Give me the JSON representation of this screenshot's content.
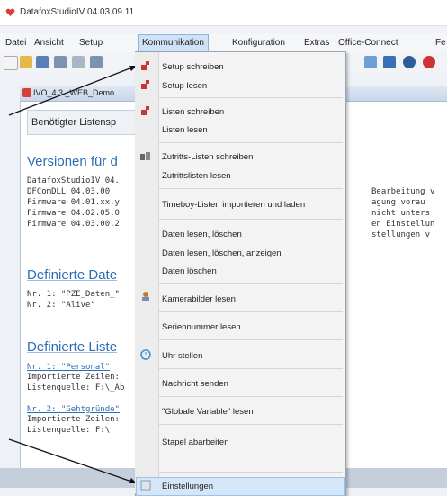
{
  "window": {
    "title": "DatafoxStudioIV 04.03.09.11"
  },
  "menubar": [
    {
      "label": "Datei"
    },
    {
      "label": "Ansicht"
    },
    {
      "label": "Setup"
    },
    {
      "label": "Kommunikation"
    },
    {
      "label": "Konfiguration"
    },
    {
      "label": "Extras"
    },
    {
      "label": "Office-Connect"
    },
    {
      "label": "Fe"
    }
  ],
  "doc": {
    "tab_title": "IVO_4.3._WEB_Demo",
    "needed_label": "Benötigter Listensp",
    "versions_heading": "Versionen für d",
    "version_lines": [
      "DatafoxStudioIV 04.",
      "DFComDLL 04.03.00",
      "Firmware 04.01.xx.y",
      "Firmware 04.02.05.0",
      "Firmware 04.03.00.2"
    ],
    "right_lines": [
      "Bearbeitung v",
      "agung vorau",
      "nicht unters",
      "en Einstellun",
      "stellungen v"
    ],
    "defined_data_heading": "Definierte Date",
    "data_lines": [
      "Nr. 1: \"PZE_Daten_\"",
      "Nr. 2: \"Alive\""
    ],
    "defined_lists_heading": "Definierte Liste",
    "list1_link": "Nr. 1: \"Personal\"",
    "list1_lines": [
      "Importierte Zeilen:",
      "Listenquelle: F:\\_Ab"
    ],
    "list2_link": "Nr. 2: \"Gehtgründe\"",
    "list2_lines": [
      "Importierte Zeilen:",
      "Listenquelle: F:\\"
    ]
  },
  "dropdown": [
    "Setup schreiben",
    "Setup lesen",
    "Listen schreiben",
    "Listen lesen",
    "Zutritts-Listen schreiben",
    "Zutrittslisten lesen",
    "Timeboy-Listen importieren und laden",
    "Daten lesen, löschen",
    "Daten lesen, löschen, anzeigen",
    "Daten löschen",
    "Kamerabilder lesen",
    "Seriennummer lesen",
    "Uhr stellen",
    "Nachricht senden",
    "\"Globale Variable\" lesen",
    "Stapel abarbeiten",
    "Einstellungen"
  ],
  "colors": {
    "accent": "#2c6db5",
    "highlight": "#d4e6f8",
    "menu_active": "#cfe2f7"
  }
}
